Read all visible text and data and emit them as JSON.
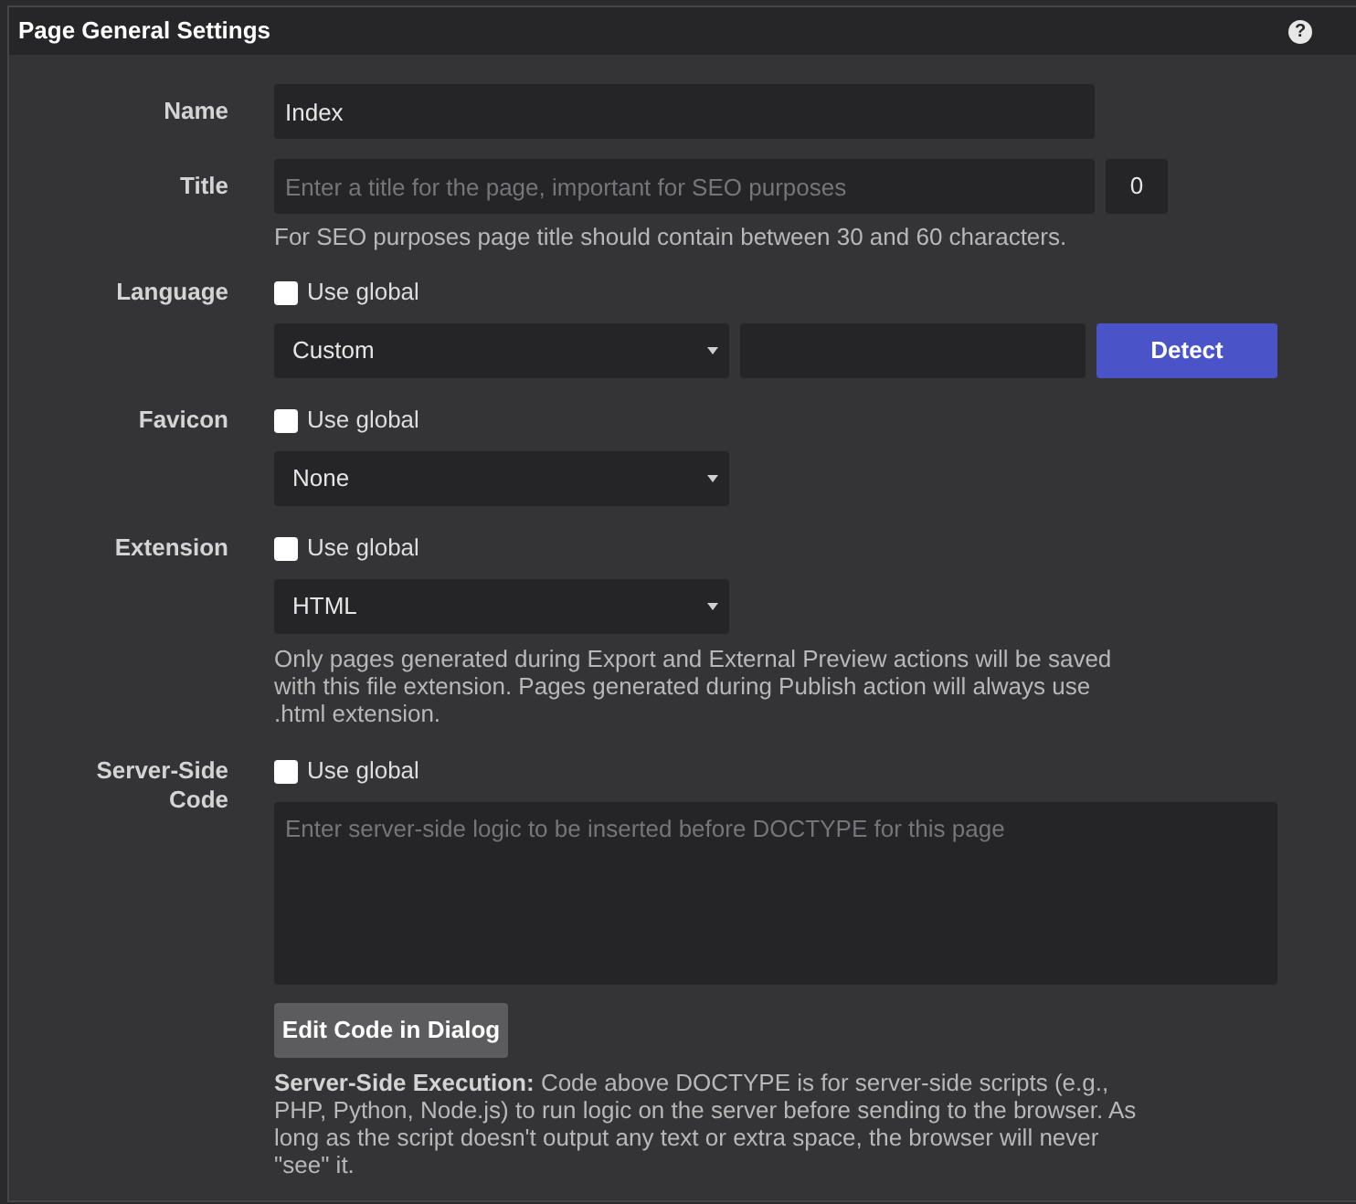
{
  "header": {
    "title": "Page General Settings",
    "help": "?"
  },
  "fields": [
    {
      "kind": "text",
      "label": "Name",
      "value": "Index"
    },
    {
      "kind": "counter",
      "label": "Title",
      "placeholder": "Enter a title for the page, important for SEO purposes",
      "count": "0",
      "help": "For SEO purposes page title should contain between 30 and 60 characters."
    },
    {
      "kind": "language",
      "label": "Language",
      "use_global": {
        "label": "Use global",
        "checked": false
      },
      "select": "Custom",
      "button": "Detect"
    },
    {
      "kind": "select",
      "label": "Favicon",
      "use_global": {
        "label": "Use global",
        "checked": false
      },
      "select": "None"
    },
    {
      "kind": "select",
      "label": "Extension",
      "use_global": {
        "label": "Use global",
        "checked": false
      },
      "select": "HTML",
      "help": "Only pages generated during Export and External Preview actions will be saved with this file extension. Pages generated during Publish action will always use .html extension."
    },
    {
      "kind": "code",
      "label": "Server-Side Code",
      "use_global": {
        "label": "Use global",
        "checked": false
      },
      "placeholder": "Enter server-side logic to be inserted before DOCTYPE for this page",
      "button": "Edit Code in Dialog",
      "note": "**Server-Side Execution:** Code above DOCTYPE is for server-side scripts (e.g., PHP, Python, Node.js) to run logic on the server before sending to the browser. As long as the script doesn't output any text or extra space, the browser will never \"see\" it."
    }
  ]
}
